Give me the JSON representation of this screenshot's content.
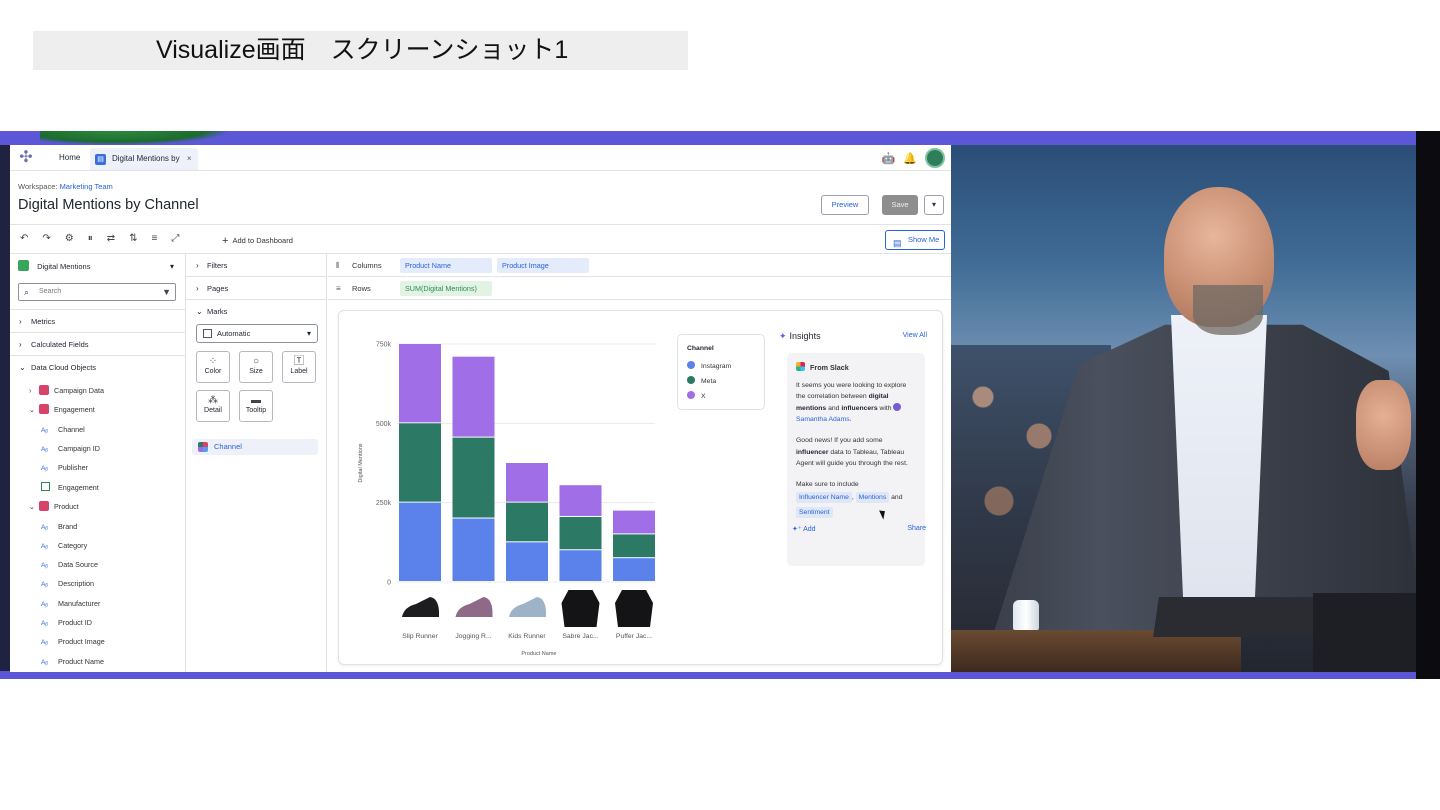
{
  "slide": {
    "title": "Visualize画面　スクリーンショット1"
  },
  "tabs": {
    "home": "Home",
    "active": "Digital Mentions by",
    "close": "×"
  },
  "header": {
    "workspace_label": "Workspace:",
    "workspace_name": "Marketing Team",
    "title": "Digital Mentions by Channel",
    "preview": "Preview",
    "save": "Save",
    "caret": "▾"
  },
  "toolbar": {
    "add_to_dashboard": "Add to Dashboard",
    "show_me": "Show Me"
  },
  "data_pane": {
    "source": "Digital Mentions",
    "search_placeholder": "Search",
    "sections": [
      "Metrics",
      "Calculated Fields",
      "Data Cloud Objects"
    ],
    "objects": [
      {
        "name": "Campaign Data",
        "expanded": false
      },
      {
        "name": "Engagement",
        "expanded": true,
        "fields": [
          "Channel",
          "Campaign ID",
          "Publisher",
          "Engagement"
        ]
      },
      {
        "name": "Product",
        "expanded": true,
        "fields": [
          "Brand",
          "Category",
          "Data Source",
          "Description",
          "Manufacturer",
          "Product ID",
          "Product Image",
          "Product Name"
        ]
      }
    ]
  },
  "cards": {
    "filters": "Filters",
    "pages": "Pages",
    "marks": "Marks",
    "mark_type": "Automatic",
    "buttons": [
      "Color",
      "Size",
      "Label",
      "Detail",
      "Tooltip"
    ],
    "channel_pill": "Channel"
  },
  "shelves": {
    "columns_label": "Columns",
    "columns": [
      "Product Name",
      "Product Image"
    ],
    "rows_label": "Rows",
    "rows": [
      "SUM(Digital Mentions)"
    ]
  },
  "chart_data": {
    "type": "bar",
    "stacked": true,
    "categories": [
      "Slip Runner",
      "Jogging R...",
      "Kids Runner",
      "Sabre Jac...",
      "Puffer Jac..."
    ],
    "series": [
      {
        "name": "Instagram",
        "color": "#5b82ea",
        "values": [
          250000,
          200000,
          125000,
          100000,
          75000
        ]
      },
      {
        "name": "Meta",
        "color": "#2c7a66",
        "values": [
          250000,
          255000,
          125000,
          105000,
          75000
        ]
      },
      {
        "name": "X",
        "color": "#a06ee6",
        "values": [
          250000,
          255000,
          125000,
          100000,
          75000
        ]
      }
    ],
    "ylim": [
      0,
      750000
    ],
    "yticks": [
      "0",
      "250k",
      "500k",
      "750k"
    ],
    "ylabel": "Digital Mentions",
    "xlabel": "Product Name",
    "legend": {
      "title": "Channel",
      "placement": "top-right"
    },
    "grid": true
  },
  "insights": {
    "title": "Insights",
    "view_all": "View All",
    "source": "From Slack",
    "p1_a": "It seems you were looking to explore the correlation between",
    "p1_b1": "digital mentions",
    "p1_and": "and",
    "p1_b2": "influencers",
    "p1_with": "with",
    "p1_person": "Samantha Adams",
    "p1_end": ".",
    "p2_a": "Good news! If you add some",
    "p2_b": "influencer",
    "p2_c": "data to Tableau, Tableau Agent will guide you through the rest.",
    "p3": "Make sure to include",
    "tags": [
      "Influencer Name",
      "Mentions",
      "Sentiment"
    ],
    "and": "and",
    "comma": ",",
    "add": "Add",
    "share": "Share"
  }
}
